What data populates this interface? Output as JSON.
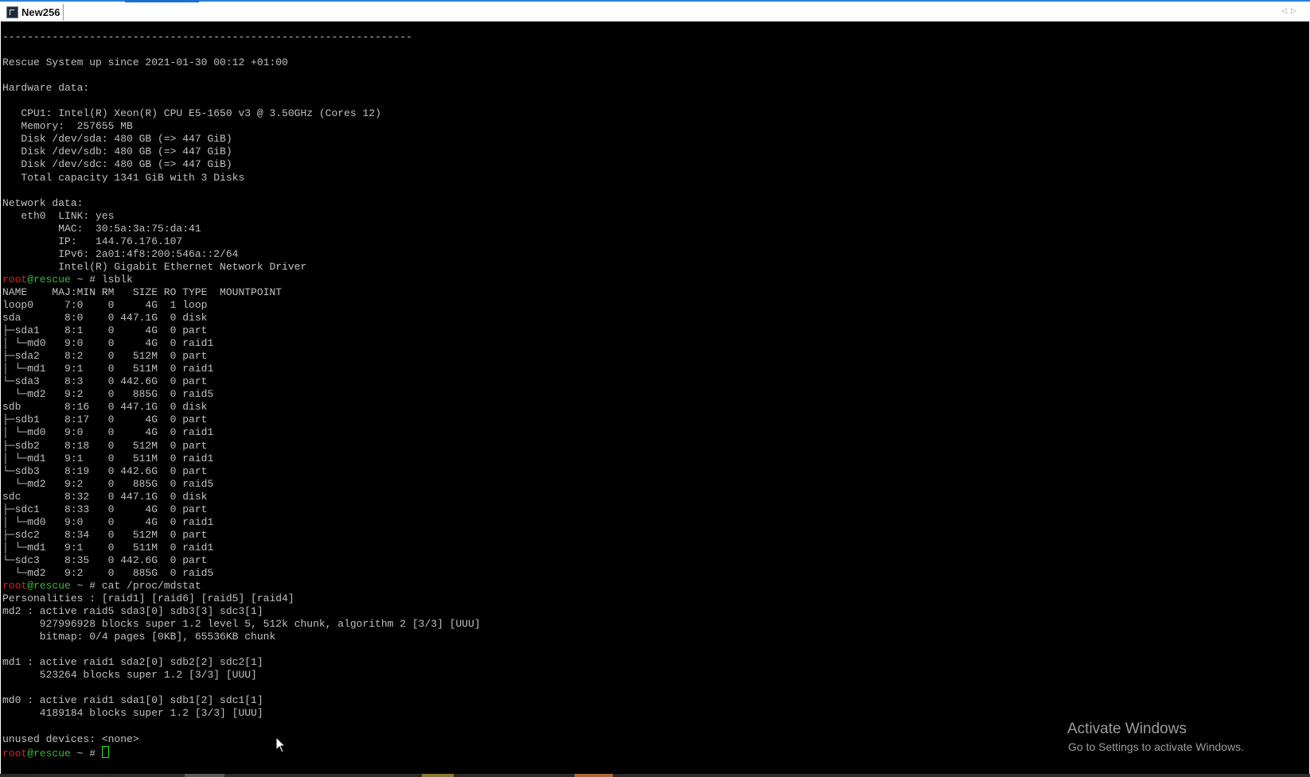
{
  "window": {
    "tab_title": "New256",
    "tab_icon": "terminal-icon",
    "nav_left": "◁",
    "nav_right": "▷"
  },
  "terminal": {
    "output_before_lsblk": "------------------------------------------------------------------\n\nRescue System up since 2021-01-30 00:12 +01:00\n\nHardware data:\n\n   CPU1: Intel(R) Xeon(R) CPU E5-1650 v3 @ 3.50GHz (Cores 12)\n   Memory:  257655 MB\n   Disk /dev/sda: 480 GB (=> 447 GiB)\n   Disk /dev/sdb: 480 GB (=> 447 GiB)\n   Disk /dev/sdc: 480 GB (=> 447 GiB)\n   Total capacity 1341 GiB with 3 Disks\n\nNetwork data:\n   eth0  LINK: yes\n         MAC:  30:5a:3a:75:da:41\n         IP:   144.76.176.107\n         IPv6: 2a01:4f8:200:546a::2/64\n         Intel(R) Gigabit Ethernet Network Driver\n",
    "prompt_user": "root",
    "prompt_host": "@rescue",
    "prompt_tail": " ~ # ",
    "cmd1": "lsblk",
    "lsblk_output": "NAME    MAJ:MIN RM   SIZE RO TYPE  MOUNTPOINT\nloop0     7:0    0     4G  1 loop\nsda       8:0    0 447.1G  0 disk\n├─sda1    8:1    0     4G  0 part\n│ └─md0   9:0    0     4G  0 raid1\n├─sda2    8:2    0   512M  0 part\n│ └─md1   9:1    0   511M  0 raid1\n└─sda3    8:3    0 442.6G  0 part\n  └─md2   9:2    0   885G  0 raid5\nsdb       8:16   0 447.1G  0 disk\n├─sdb1    8:17   0     4G  0 part\n│ └─md0   9:0    0     4G  0 raid1\n├─sdb2    8:18   0   512M  0 part\n│ └─md1   9:1    0   511M  0 raid1\n└─sdb3    8:19   0 442.6G  0 part\n  └─md2   9:2    0   885G  0 raid5\nsdc       8:32   0 447.1G  0 disk\n├─sdc1    8:33   0     4G  0 part\n│ └─md0   9:0    0     4G  0 raid1\n├─sdc2    8:34   0   512M  0 part\n│ └─md1   9:1    0   511M  0 raid1\n└─sdc3    8:35   0 442.6G  0 part\n  └─md2   9:2    0   885G  0 raid5",
    "cmd2": "cat /proc/mdstat",
    "mdstat_output": "Personalities : [raid1] [raid6] [raid5] [raid4]\nmd2 : active raid5 sda3[0] sdb3[3] sdc3[1]\n      927996928 blocks super 1.2 level 5, 512k chunk, algorithm 2 [3/3] [UUU]\n      bitmap: 0/4 pages [0KB], 65536KB chunk\n\nmd1 : active raid1 sda2[0] sdb2[2] sdc2[1]\n      523264 blocks super 1.2 [3/3] [UUU]\n\nmd0 : active raid1 sda1[0] sdb1[2] sdc1[1]\n      4189184 blocks super 1.2 [3/3] [UUU]\n\nunused devices: <none>",
    "cmd3": ""
  },
  "watermark": {
    "title": "Activate Windows",
    "subtitle": "Go to Settings to activate Windows."
  },
  "colors": {
    "terminal_bg": "#000000",
    "terminal_fg": "#c0c0c0",
    "prompt_user": "#e02020",
    "prompt_host": "#2fbf2f"
  }
}
